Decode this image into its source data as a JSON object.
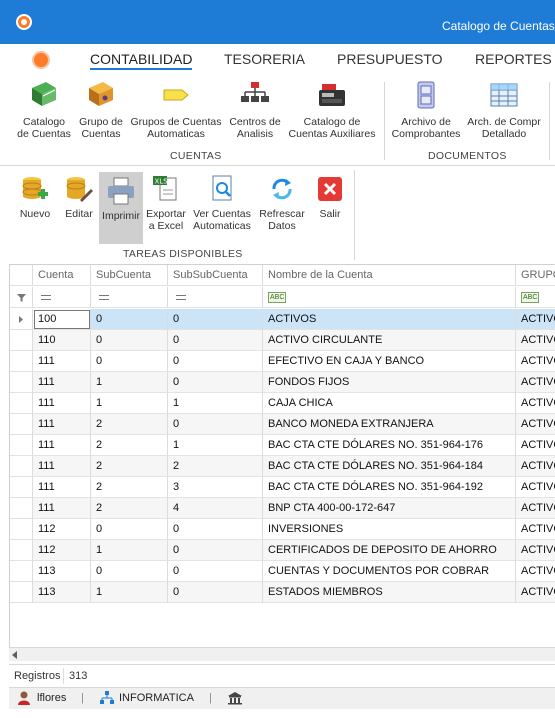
{
  "window": {
    "title": "Catalogo de Cuentas - S"
  },
  "ribbon": {
    "tabs": [
      "CONTABILIDAD",
      "TESORERIA",
      "PRESUPUESTO",
      "REPORTES"
    ],
    "active_tab": "CONTABILIDAD",
    "groups": [
      {
        "label": "CUENTAS",
        "buttons": [
          {
            "label1": "Catalogo",
            "label2": "de Cuentas",
            "icon": "green-book-icon"
          },
          {
            "label1": "Grupo de",
            "label2": "Cuentas",
            "icon": "gold-book-icon"
          },
          {
            "label1": "Grupos de Cuentas",
            "label2": "Automaticas",
            "icon": "tag-icon"
          },
          {
            "label1": "Centros de",
            "label2": "Analisis",
            "icon": "org-chart-icon"
          },
          {
            "label1": "Catalogo de",
            "label2": "Cuentas Auxiliares",
            "icon": "cash-register-icon"
          }
        ]
      },
      {
        "label": "DOCUMENTOS",
        "buttons": [
          {
            "label1": "Archivo de",
            "label2": "Comprobantes",
            "icon": "file-cabinet-icon"
          },
          {
            "label1": "Arch. de Compr",
            "label2": "Detallado",
            "icon": "table-icon"
          }
        ]
      }
    ]
  },
  "toolbar": {
    "group_label": "TAREAS DISPONIBLES",
    "buttons": [
      {
        "label1": "Nuevo",
        "label2": "",
        "icon": "database-add-icon"
      },
      {
        "label1": "Editar",
        "label2": "",
        "icon": "database-edit-icon"
      },
      {
        "label1": "Imprimir",
        "label2": "",
        "icon": "printer-icon"
      },
      {
        "label1": "Exportar",
        "label2": "a Excel",
        "icon": "xls-export-icon"
      },
      {
        "label1": "Ver Cuentas",
        "label2": "Automaticas",
        "icon": "search-document-icon"
      },
      {
        "label1": "Refrescar",
        "label2": "Datos",
        "icon": "refresh-icon"
      },
      {
        "label1": "Salir",
        "label2": "",
        "icon": "close-icon"
      }
    ]
  },
  "grid": {
    "columns": [
      "Cuenta",
      "SubCuenta",
      "SubSubCuenta",
      "Nombre de la Cuenta",
      "GRUPO"
    ],
    "rows": [
      [
        "100",
        "0",
        "0",
        "ACTIVOS",
        "ACTIVO"
      ],
      [
        "110",
        "0",
        "0",
        "ACTIVO CIRCULANTE",
        "ACTIVO"
      ],
      [
        "111",
        "0",
        "0",
        "EFECTIVO EN CAJA Y BANCO",
        "ACTIVO"
      ],
      [
        "111",
        "1",
        "0",
        "FONDOS FIJOS",
        "ACTIVO"
      ],
      [
        "111",
        "1",
        "1",
        "CAJA CHICA",
        "ACTIVO"
      ],
      [
        "111",
        "2",
        "0",
        "BANCO MONEDA EXTRANJERA",
        "ACTIVO"
      ],
      [
        "111",
        "2",
        "1",
        "BAC CTA CTE DÓLARES NO. 351-964-176",
        "ACTIVO"
      ],
      [
        "111",
        "2",
        "2",
        "BAC CTA CTE DÓLARES NO. 351-964-184",
        "ACTIVO"
      ],
      [
        "111",
        "2",
        "3",
        "BAC CTA CTE DÓLARES NO. 351-964-192",
        "ACTIVO"
      ],
      [
        "111",
        "2",
        "4",
        "BNP CTA 400-00-172-647",
        "ACTIVO"
      ],
      [
        "112",
        "0",
        "0",
        "INVERSIONES",
        "ACTIVO"
      ],
      [
        "112",
        "1",
        "0",
        "CERTIFICADOS DE DEPOSITO DE AHORRO",
        "ACTIVO"
      ],
      [
        "113",
        "0",
        "0",
        "CUENTAS Y DOCUMENTOS POR COBRAR",
        "ACTIVO"
      ],
      [
        "113",
        "1",
        "0",
        "ESTADOS MIEMBROS",
        "ACTIVO"
      ]
    ],
    "selected_row": 0
  },
  "records": {
    "label": "Registros",
    "count": "313"
  },
  "status": {
    "user": "lflores",
    "department": "INFORMATICA",
    "separator": "|"
  }
}
